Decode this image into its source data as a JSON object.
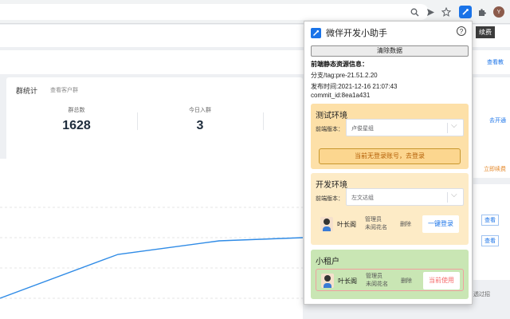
{
  "browser": {
    "avatar_initial": "Y",
    "icons": [
      "zoom-icon",
      "send-icon",
      "star-icon",
      "extension-active-icon",
      "puzzle-icon"
    ]
  },
  "page": {
    "group_stats": {
      "title": "群统计",
      "link": "查看客户群",
      "items": [
        {
          "label": "群总数",
          "value": "1628"
        },
        {
          "label": "今日入群",
          "value": "3"
        }
      ]
    },
    "right": {
      "tag": "续费",
      "link1": "查看教",
      "link2": "去开通",
      "link3": "立即续费",
      "btn1": "查看",
      "btn2": "查看",
      "text1": "透过招"
    }
  },
  "popup": {
    "title": "微伴开发小助手",
    "help": "?",
    "clear_button": "清除数据",
    "info_label": "前端静态资源信息：",
    "branch": "分支/tag:pre-21.51.2.20",
    "publish_time": "发布时间:2021-12-16 21:07:43",
    "commit_id": "commit_id:8ea1a431",
    "envs": [
      {
        "title": "测试环境",
        "select_label": "前端版本：",
        "select_value": "卢俊星组",
        "login_hint": "当前无登录账号，去登录"
      },
      {
        "title": "开发环境",
        "select_label": "前端版本：",
        "select_value": "左文达组",
        "user": {
          "name": "叶长阁",
          "role1": "管理员",
          "role2": "未阅花名",
          "delete": "删除",
          "action": "一键登录"
        }
      },
      {
        "title": "小租户",
        "user": {
          "name": "叶长阁",
          "role1": "管理员",
          "role2": "未阅花名",
          "delete": "删除",
          "action": "当前使用"
        }
      }
    ],
    "colors": {
      "test_bg": "#fde0a8",
      "dev_bg": "#fdebc6",
      "tenant_bg": "#c9e6b4",
      "login_btn": "#1a73e8",
      "current_btn": "#f56c6c"
    }
  }
}
